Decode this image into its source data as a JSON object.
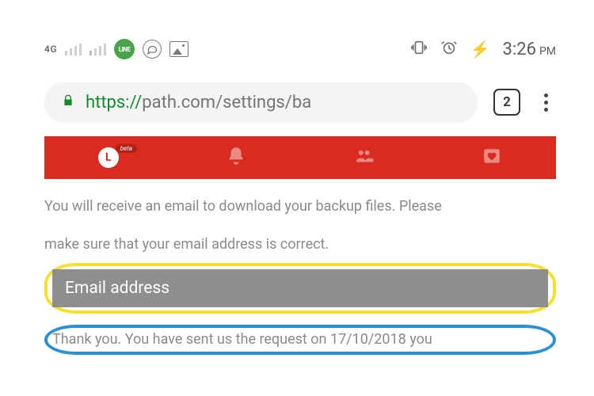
{
  "status_bar": {
    "network_label": "4G",
    "line_app": "LINE",
    "time": "3:26",
    "ampm": "PM"
  },
  "browser": {
    "url_scheme": "https://",
    "url_rest": "path.com/settings/ba",
    "tab_count": "2"
  },
  "app_nav": {
    "clock_letter": "L",
    "beta_label": "beta"
  },
  "content": {
    "line1": "You will receive an email to download your backup files. Please",
    "line2": "make sure that your email address is correct.",
    "email_placeholder": "Email address",
    "thankyou": "Thank you. You have sent us the request on 17/10/2018 you"
  }
}
